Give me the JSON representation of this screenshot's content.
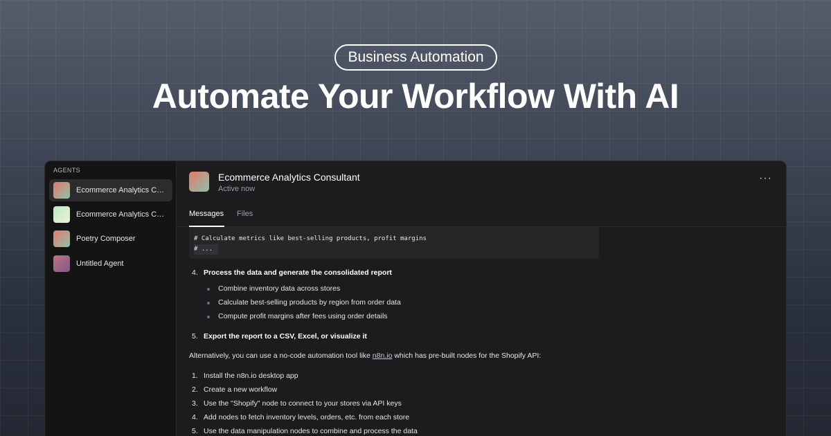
{
  "hero": {
    "pill": "Business Automation",
    "headline": "Automate Your Workflow With AI"
  },
  "sidebar": {
    "title": "AGENTS",
    "agents": [
      {
        "label": "Ecommerce Analytics Consultant",
        "gradient": [
          "#e07a6e",
          "#8fc1a6"
        ],
        "active": true
      },
      {
        "label": "Ecommerce Analytics Consultant",
        "gradient": [
          "#bfe7c9",
          "#e8f5d3"
        ],
        "active": false
      },
      {
        "label": "Poetry Composer",
        "gradient": [
          "#e07a6e",
          "#8fc1a6"
        ],
        "active": false
      },
      {
        "label": "Untitled Agent",
        "gradient": [
          "#c46f84",
          "#7a5d85"
        ],
        "active": false
      }
    ]
  },
  "header": {
    "title": "Ecommerce Analytics Consultant",
    "status": "Active now",
    "more": "···"
  },
  "tabs": {
    "messages": "Messages",
    "files": "Files"
  },
  "code": {
    "line1": "# Calculate metrics like best-selling products, profit margins",
    "line2": "# ..."
  },
  "message": {
    "step4_num": "4.",
    "step4": "Process the data and generate the consolidated report",
    "step4_bullets": [
      "Combine inventory data across stores",
      "Calculate best-selling products by region from order data",
      "Compute profit margins after fees using order details"
    ],
    "step5_num": "5.",
    "step5": "Export the report to a CSV, Excel, or visualize it",
    "alt_prefix": "Alternatively, you can use a no-code automation tool like ",
    "alt_link": "n8n.io",
    "alt_suffix": " which has pre-built nodes for the Shopify API:",
    "list": [
      {
        "num": "1.",
        "text": "Install the n8n.io desktop app"
      },
      {
        "num": "2.",
        "text": "Create a new workflow"
      },
      {
        "num": "3.",
        "text": "Use the \"Shopify\" node to connect to your stores via API keys"
      },
      {
        "num": "4.",
        "text": "Add nodes to fetch inventory levels, orders, etc. from each store"
      },
      {
        "num": "5.",
        "text": "Use the data manipulation nodes to combine and process the data"
      }
    ]
  }
}
